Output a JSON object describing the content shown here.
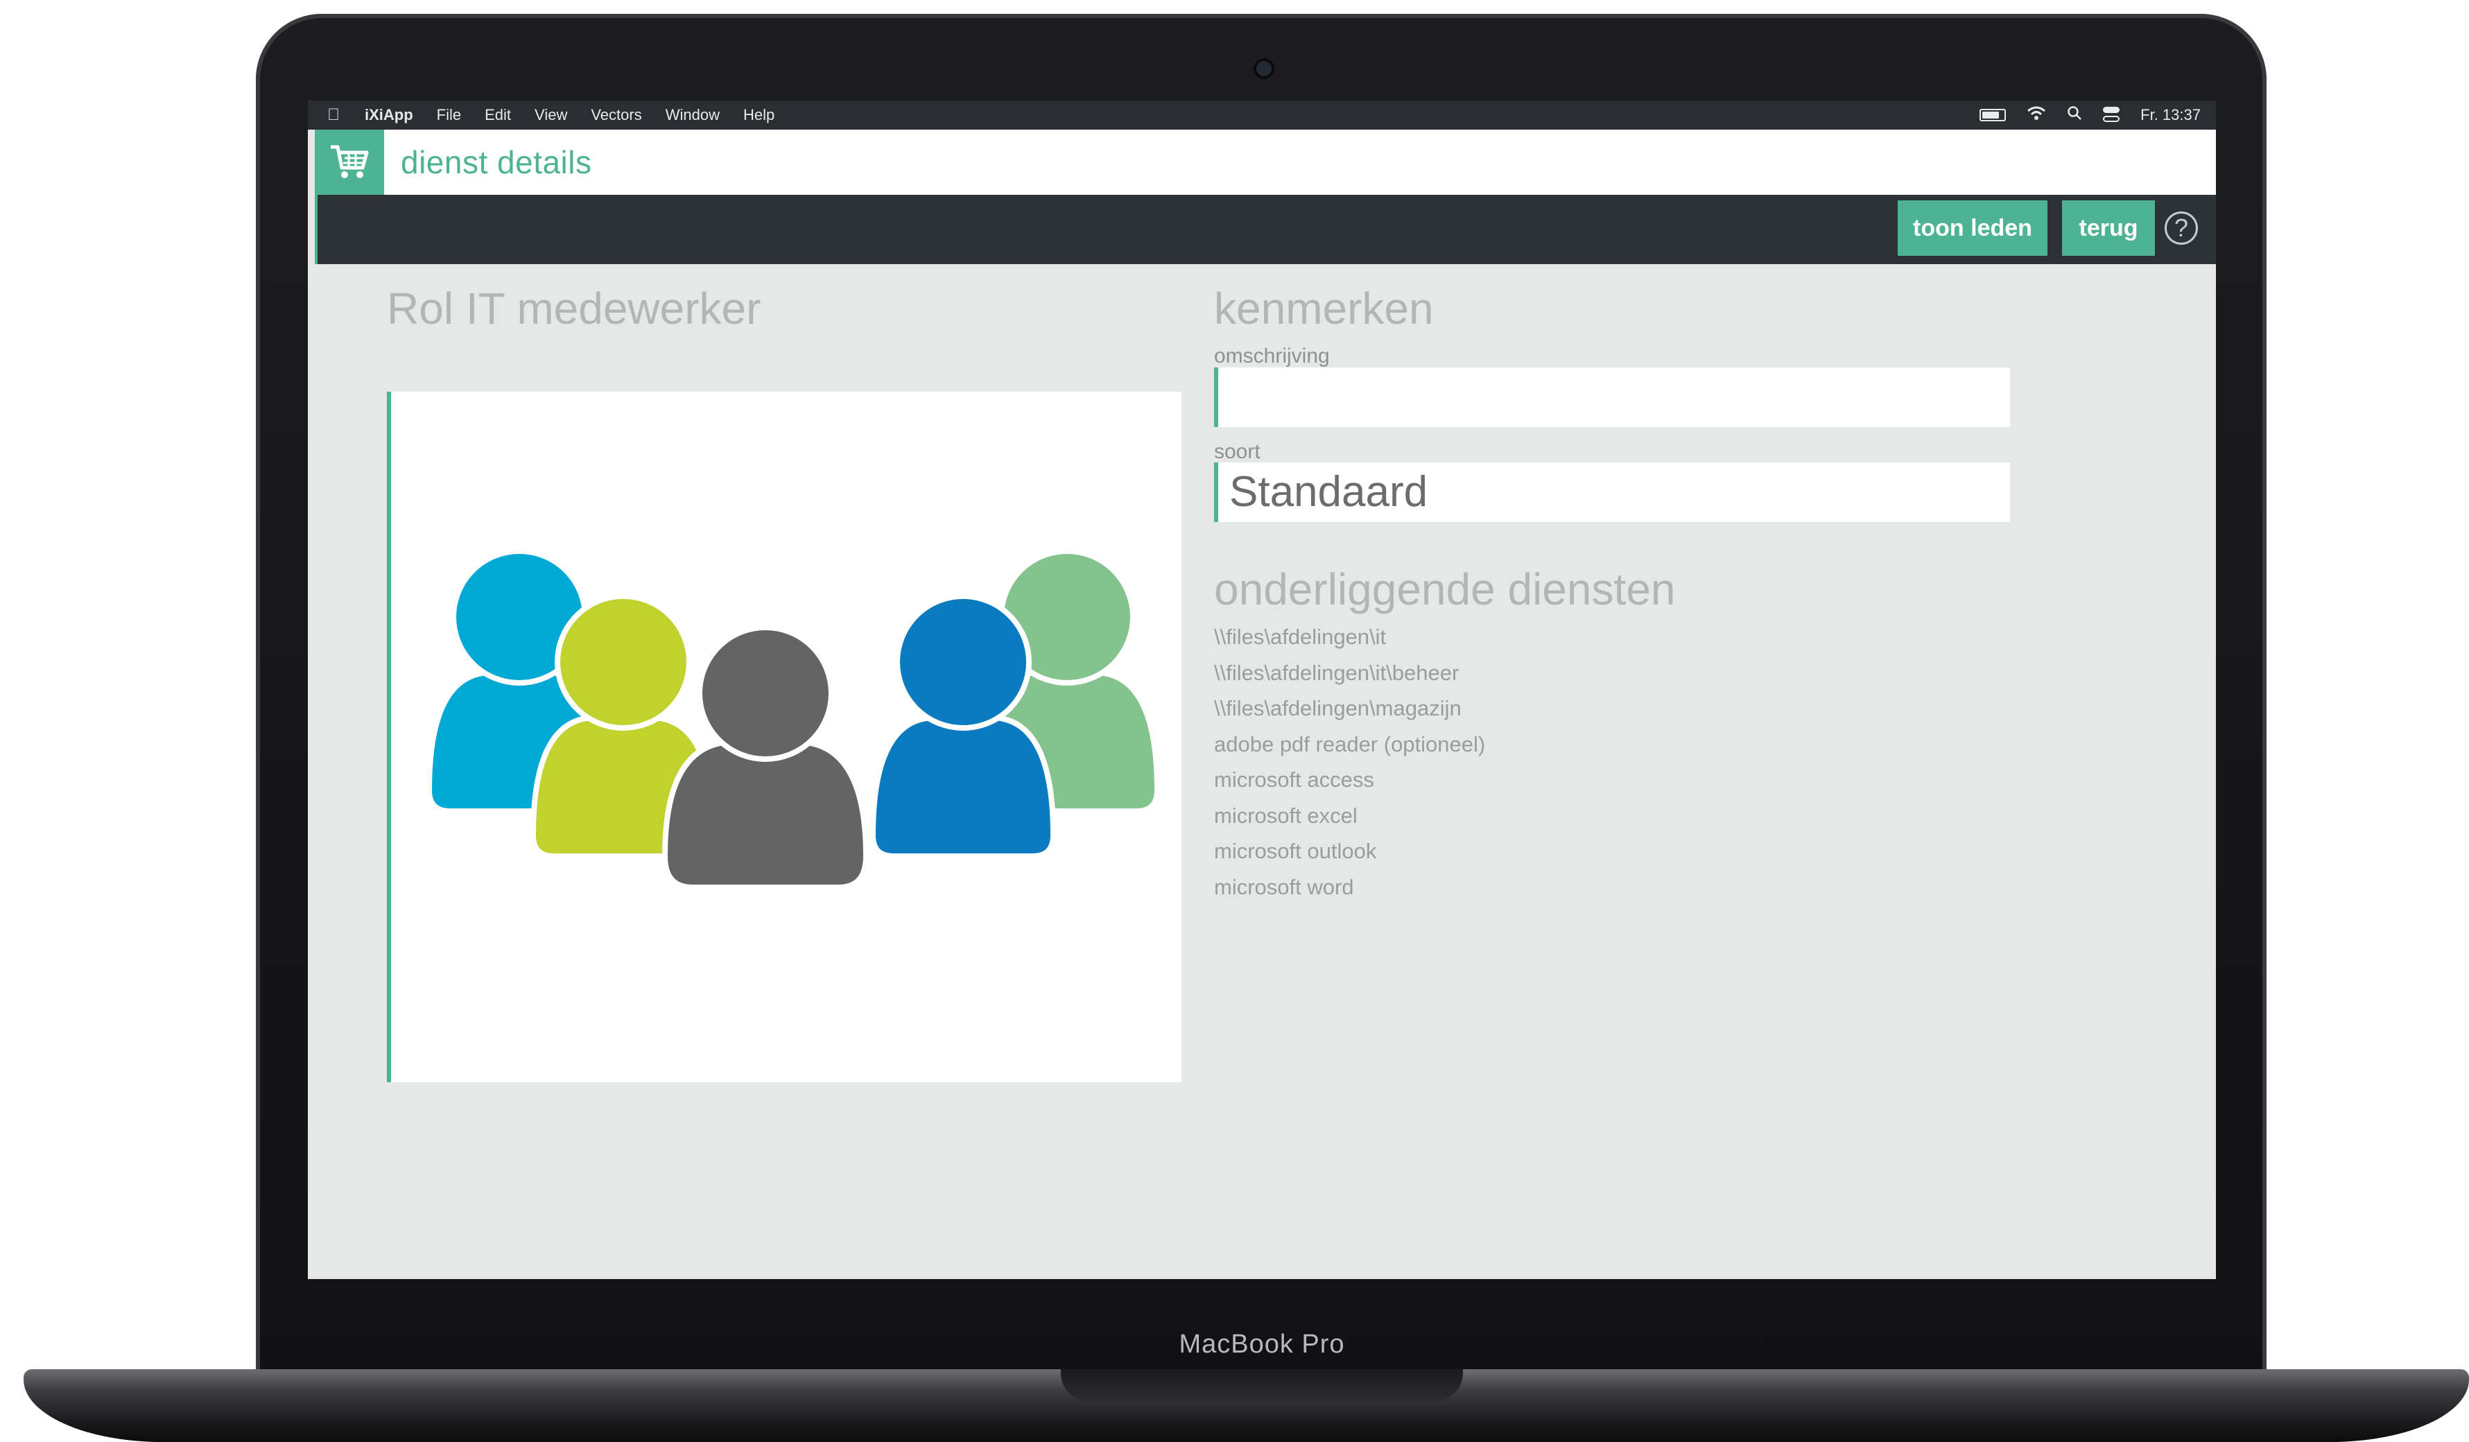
{
  "device": {
    "label": "MacBook Pro"
  },
  "menubar": {
    "items": [
      "iXiApp",
      "File",
      "Edit",
      "View",
      "Vectors",
      "Window",
      "Help"
    ],
    "clock": "Fr. 13:37"
  },
  "window": {
    "title": "dienst details"
  },
  "toolbar": {
    "show_members_label": "toon leden",
    "back_label": "terug",
    "help_label": "?"
  },
  "role": {
    "title": "Rol IT medewerker",
    "image_colors": [
      "#02a9d4",
      "#c1d22f",
      "#646464",
      "#0a7bbf",
      "#84c28e"
    ]
  },
  "kenmerken": {
    "title": "kenmerken",
    "description_label": "omschrijving",
    "description_value": "",
    "type_label": "soort",
    "type_value": "Standaard"
  },
  "underlying": {
    "title": "onderliggende diensten",
    "items": [
      "\\\\files\\afdelingen\\it",
      "\\\\files\\afdelingen\\it\\beheer",
      "\\\\files\\afdelingen\\magazijn",
      "adobe pdf reader (optioneel)",
      "microsoft access",
      "microsoft excel",
      "microsoft outlook",
      "microsoft word"
    ]
  },
  "colors": {
    "accent": "#4db393",
    "toolbar": "#2c3237",
    "background": "#e6e8e8"
  }
}
